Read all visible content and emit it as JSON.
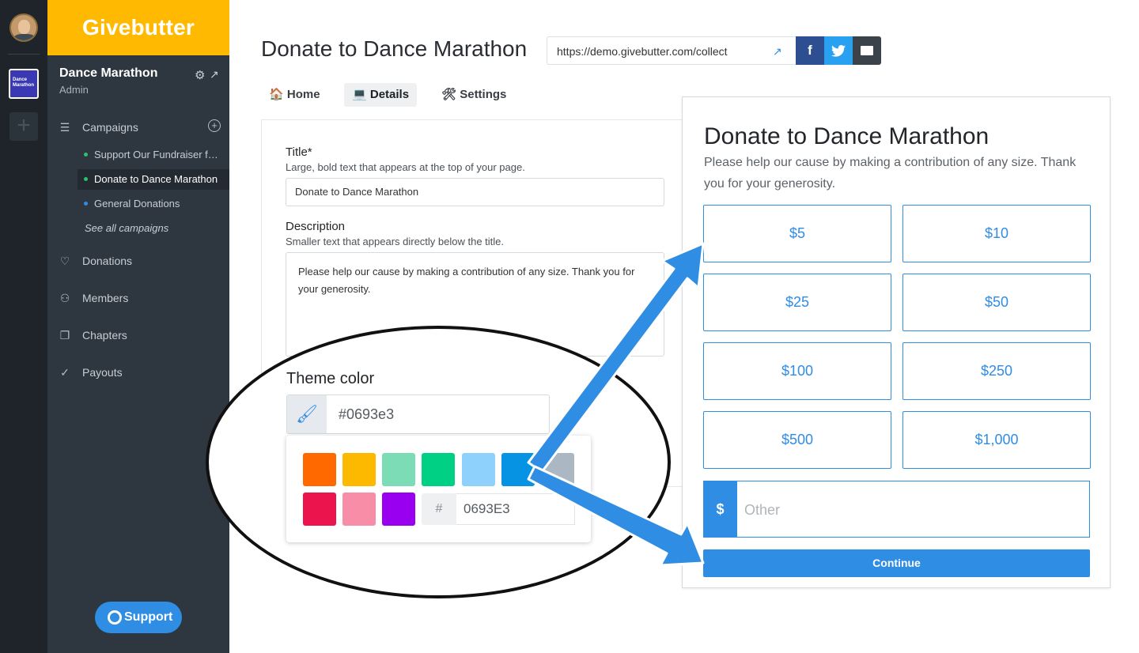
{
  "colors": {
    "brand_yellow": "#ffb900",
    "accent_blue": "#2f8de4",
    "selected_swatch": "#0693e3"
  },
  "rail": {
    "org_tile_text": "Dance Marathon",
    "add_icon": "plus-icon"
  },
  "sidebar": {
    "brand": "Givebutter",
    "org_name": "Dance Marathon",
    "org_role": "Admin",
    "nav": [
      {
        "label": "Campaigns",
        "icon": "list-icon"
      },
      {
        "label": "Donations",
        "icon": "heart-icon"
      },
      {
        "label": "Members",
        "icon": "members-icon"
      },
      {
        "label": "Chapters",
        "icon": "copy-icon"
      },
      {
        "label": "Payouts",
        "icon": "check-circle-icon"
      }
    ],
    "campaigns": [
      {
        "label": "Support Our Fundraiser f…",
        "dot": "#2bc46a"
      },
      {
        "label": "Donate to Dance Marathon",
        "dot": "#2bc46a"
      },
      {
        "label": "General Donations",
        "dot": "#2f8de4"
      }
    ],
    "see_all": "See all campaigns",
    "support": "Support"
  },
  "header": {
    "title": "Donate to Dance Marathon",
    "url": "https://demo.givebutter.com/collect",
    "share": {
      "facebook": "f",
      "twitter": "t"
    }
  },
  "tabs": [
    {
      "icon": "🏠",
      "label": "Home"
    },
    {
      "icon": "💻",
      "label": "Details"
    },
    {
      "icon": "🛠",
      "label": "Settings"
    }
  ],
  "form": {
    "title_label": "Title*",
    "title_hint": "Large, bold text that appears at the top of your page.",
    "title_value": "Donate to Dance Marathon",
    "description_label": "Description",
    "description_hint": "Smaller text that appears directly below the title.",
    "description_value": "Please help our cause by making a contribution of any size. Thank you for your generosity.",
    "theme_label": "Theme color",
    "theme_value": "#0693e3",
    "hex_hash": "#",
    "hex_value": "0693E3",
    "swatches": [
      "#ff6900",
      "#fcb900",
      "#7bdcb5",
      "#00d084",
      "#8ed1fc",
      "#0693e3",
      "#abb8c3",
      "#eb144c",
      "#f78da7",
      "#9900ef"
    ]
  },
  "preview": {
    "title": "Donate to Dance Marathon",
    "description": "Please help our cause by making a contribution of any size. Thank you for your generosity.",
    "amounts": [
      "$5",
      "$10",
      "$25",
      "$50",
      "$100",
      "$250",
      "$500",
      "$1,000"
    ],
    "currency": "$",
    "other_placeholder": "Other",
    "continue": "Continue"
  }
}
